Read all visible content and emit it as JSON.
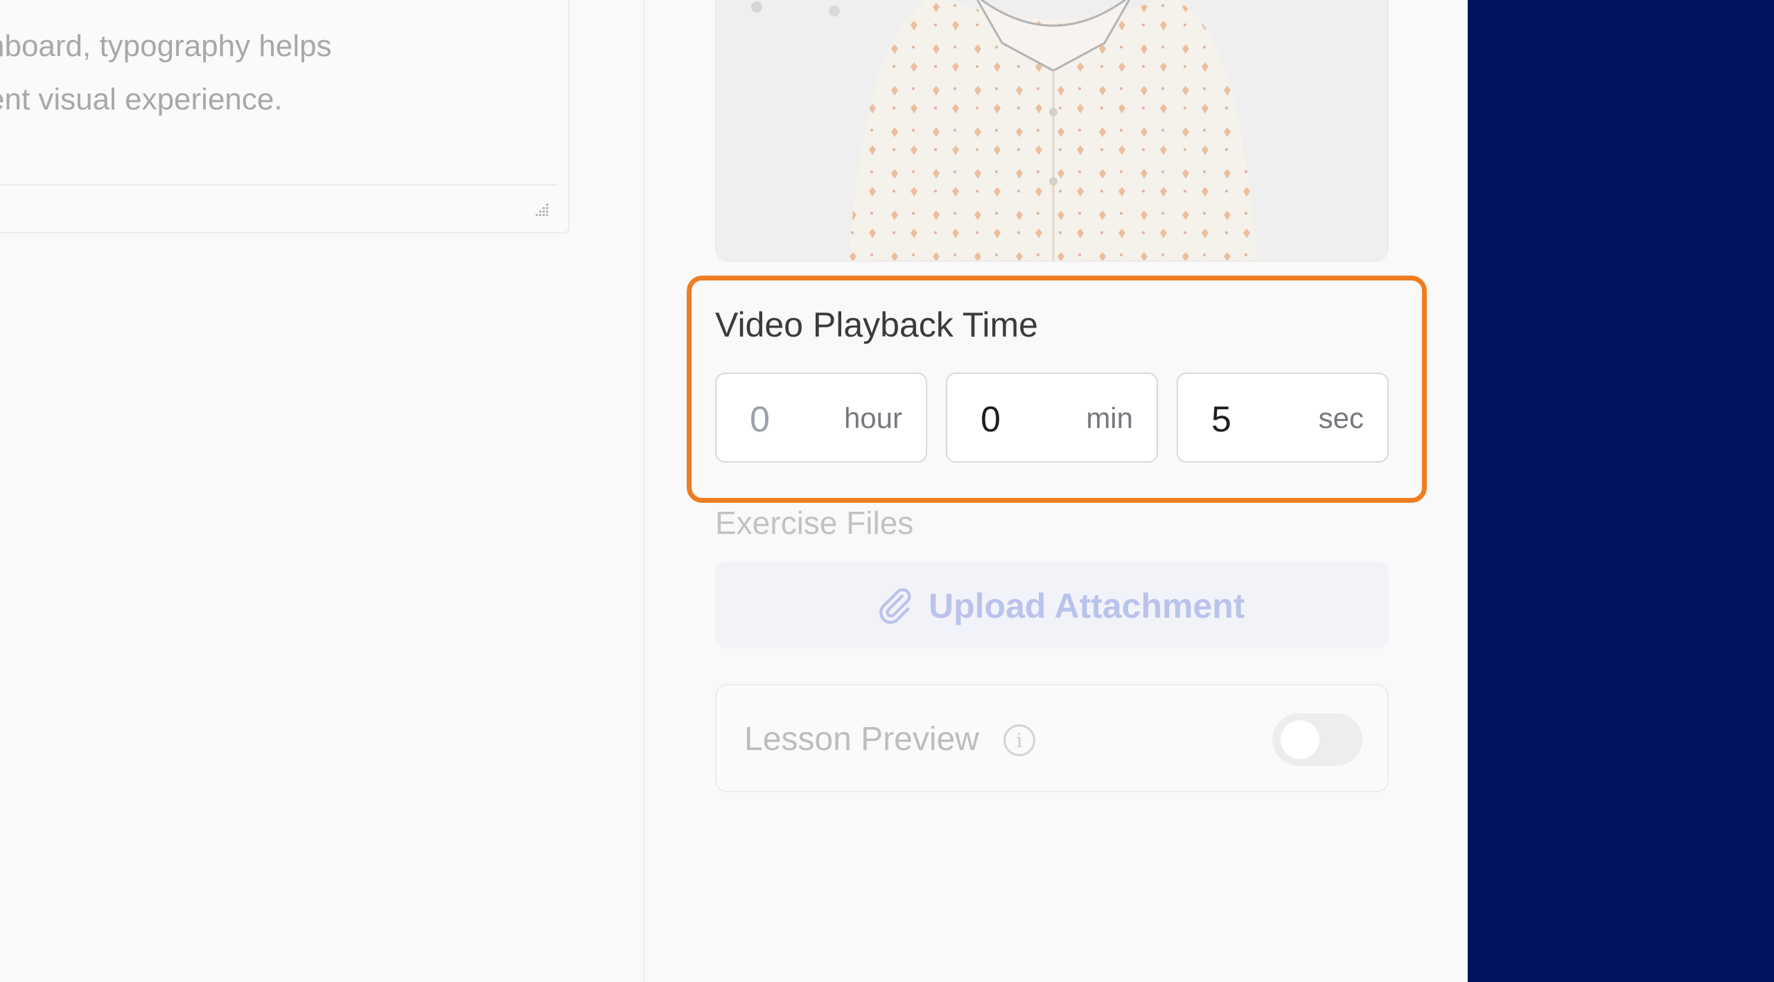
{
  "description": {
    "line1": "hboard, typography helps",
    "line2": "ent visual experience."
  },
  "video_playback": {
    "title": "Video Playback Time",
    "hours": {
      "value": "0",
      "unit": "hour"
    },
    "minutes": {
      "value": "0",
      "unit": "min"
    },
    "seconds": {
      "value": "5",
      "unit": "sec"
    }
  },
  "exercise_files": {
    "label": "Exercise Files",
    "upload_label": "Upload Attachment"
  },
  "lesson_preview": {
    "label": "Lesson Preview",
    "enabled": false
  },
  "colors": {
    "highlight": "#ee7d22",
    "side_panel": "#01135f",
    "upload_accent": "#b9c3ec"
  },
  "icons": [
    "resize-grip-icon",
    "paperclip-icon",
    "info-icon"
  ]
}
